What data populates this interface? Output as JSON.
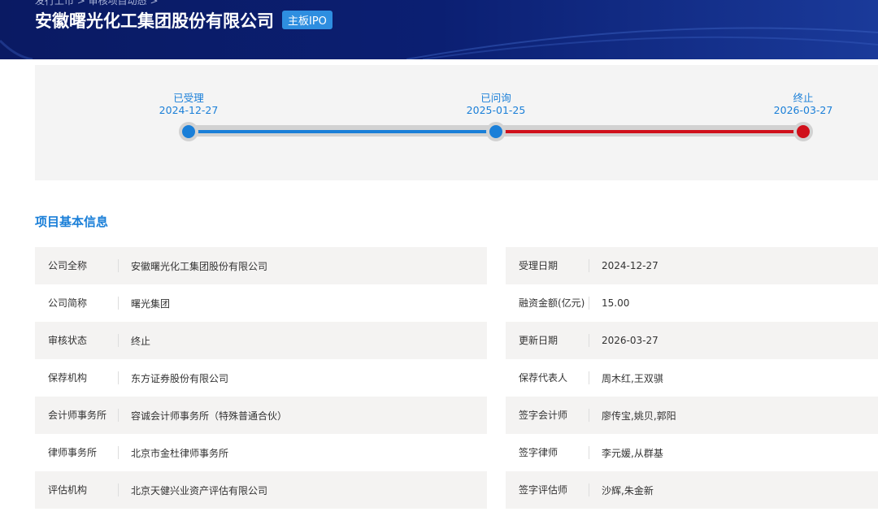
{
  "header": {
    "breadcrumb": "发行上市  >  审核项目动态  >",
    "title": "安徽曙光化工集团股份有限公司",
    "badge": "主板IPO"
  },
  "progress": {
    "steps": [
      {
        "label": "已受理",
        "date": "2024-12-27"
      },
      {
        "label": "已问询",
        "date": "2025-01-25"
      },
      {
        "label": "终止",
        "date": "2026-03-27"
      }
    ],
    "colors": {
      "done": "#1a7fd8",
      "terminated": "#d0101b"
    }
  },
  "section_title": "项目基本信息",
  "info": [
    {
      "l_label": "公司全称",
      "l_value": "安徽曙光化工集团股份有限公司",
      "r_label": "受理日期",
      "r_value": "2024-12-27"
    },
    {
      "l_label": "公司简称",
      "l_value": "曙光集团",
      "r_label": "融资金额(亿元)",
      "r_value": "15.00"
    },
    {
      "l_label": "审核状态",
      "l_value": "终止",
      "r_label": "更新日期",
      "r_value": "2026-03-27"
    },
    {
      "l_label": "保荐机构",
      "l_value": "东方证券股份有限公司",
      "r_label": "保荐代表人",
      "r_value": "周木红,王双骐"
    },
    {
      "l_label": "会计师事务所",
      "l_value": "容诚会计师事务所（特殊普通合伙）",
      "r_label": "签字会计师",
      "r_value": "廖传宝,姚贝,郭阳"
    },
    {
      "l_label": "律师事务所",
      "l_value": "北京市金杜律师事务所",
      "r_label": "签字律师",
      "r_value": "李元媛,从群基"
    },
    {
      "l_label": "评估机构",
      "l_value": "北京天健兴业资产评估有限公司",
      "r_label": "签字评估师",
      "r_value": "沙辉,朱金新"
    }
  ]
}
